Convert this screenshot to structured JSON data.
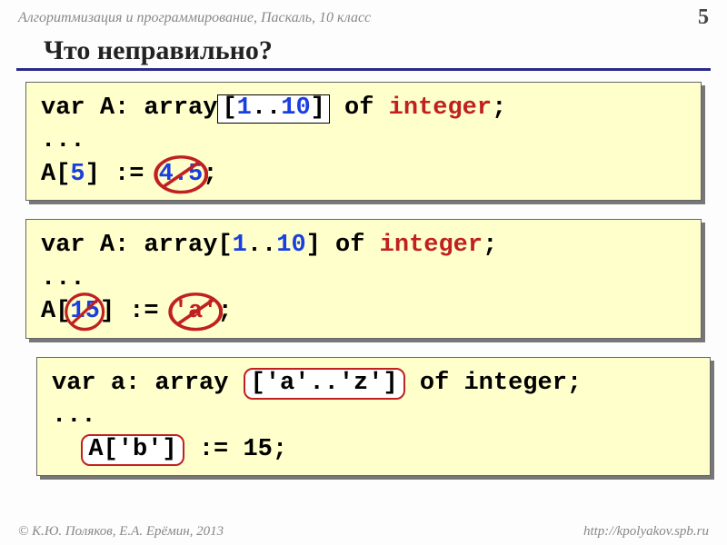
{
  "header": {
    "subject": "Алгоритмизация и программирование, Паскаль, 10 класс",
    "page": "5"
  },
  "title": "Что неправильно?",
  "box1": {
    "var": "var",
    "A": "A: ",
    "array": "array",
    "lb": "[",
    "n1": "1",
    "dots": "..",
    "n10": "10",
    "rb": "]",
    "of": " of ",
    "type": "integer",
    "semi": ";",
    "ellipsis": "...",
    "assign_l": "A[",
    "idx": "5",
    "assign_r": "]",
    "coloneq": ":=",
    "val": "4.5",
    "semi2": ";"
  },
  "box2": {
    "var": "var",
    "A": "A: ",
    "array": "array",
    "lb": "[",
    "n1": "1",
    "dots": "..",
    "n10": "10",
    "rb": "]",
    "of": " of ",
    "type": "integer",
    "semi": ";",
    "ellipsis": "...",
    "assign_l": "A[",
    "idx": "15",
    "assign_r": "]",
    "coloneq": ":=",
    "val": "'a'",
    "semi2": ";"
  },
  "box3": {
    "var": "var",
    "a": "a: ",
    "array": "array ",
    "range": "['a'..'z']",
    "of": " of ",
    "type": "integer;",
    "ellipsis": "...",
    "idx": "A['b']",
    "coloneq": " := ",
    "val": "15;"
  },
  "footer": {
    "left": "© К.Ю. Поляков, Е.А. Ерёмин, 2013",
    "right": "http://kpolyakov.spb.ru"
  }
}
